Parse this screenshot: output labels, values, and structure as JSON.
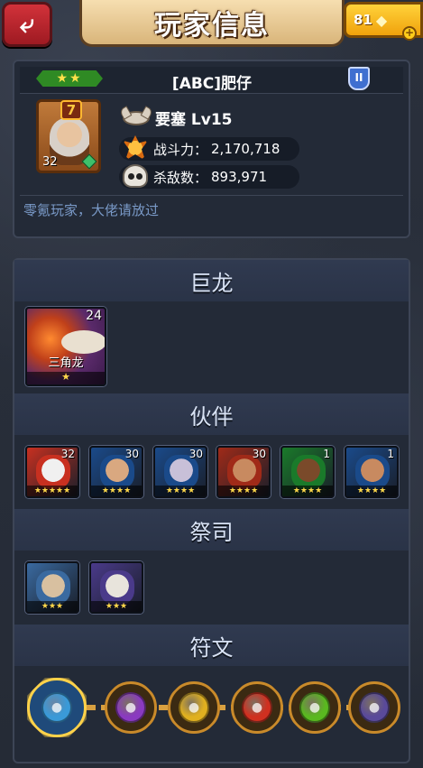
{
  "header": {
    "title": "玩家信息",
    "back_icon": "back-arrow-icon",
    "gems": "81",
    "gem_icon": "gem-icon",
    "plus_icon": "plus-icon"
  },
  "player": {
    "stars": "★★",
    "name": "[ABC]肥仔",
    "rank_badge": "II",
    "avatar_badge": "7",
    "avatar_level": "32",
    "fortress": "要塞 Lv15",
    "power_label": "战斗力：",
    "power_value": "2,170,718",
    "kills_label": "杀敌数：",
    "kills_value": "893,971",
    "motto": "零氪玩家，大佬请放过"
  },
  "sections": {
    "dragon": "巨龙",
    "partners": "伙伴",
    "priests": "祭司",
    "runes": "符文"
  },
  "dragon": {
    "name": "三角龙",
    "level": "24",
    "stars": "★"
  },
  "partners": [
    {
      "level": "32",
      "stars": "★★★★★",
      "colors": [
        "#c83020",
        "#f0f0f0"
      ]
    },
    {
      "level": "30",
      "stars": "★★★★",
      "colors": [
        "#1a4a8a",
        "#d9a880"
      ]
    },
    {
      "level": "30",
      "stars": "★★★★",
      "colors": [
        "#1a4a8a",
        "#c8c0d8"
      ]
    },
    {
      "level": "30",
      "stars": "★★★★",
      "colors": [
        "#a02a18",
        "#c88a60"
      ]
    },
    {
      "level": "1",
      "stars": "★★★★",
      "colors": [
        "#1a7a2a",
        "#7a4a2a"
      ]
    },
    {
      "level": "1",
      "stars": "★★★★",
      "colors": [
        "#1a4a8a",
        "#c88a60"
      ]
    }
  ],
  "priests": [
    {
      "stars": "★★★",
      "colors": [
        "#3a6aa0",
        "#d8c0a0"
      ]
    },
    {
      "stars": "★★★",
      "colors": [
        "#4a3a8a",
        "#e8e4dc"
      ]
    }
  ],
  "runes": [
    {
      "color": "#3a9ad8",
      "selected": true
    },
    {
      "color": "#8a3ac0",
      "selected": false
    },
    {
      "color": "#e0b020",
      "selected": false
    },
    {
      "color": "#d03020",
      "selected": false
    },
    {
      "color": "#5ab820",
      "selected": false
    },
    {
      "color": "#5a4a9a",
      "selected": false
    }
  ]
}
